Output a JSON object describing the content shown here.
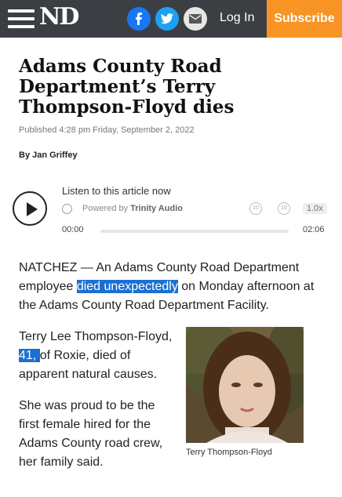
{
  "header": {
    "logo": "ND",
    "login_label": "Log In",
    "subscribe_label": "Subscribe"
  },
  "article": {
    "headline": "Adams County Road Department’s Terry Thompson-Floyd dies",
    "published": "Published 4:28 pm Friday, September 2, 2022",
    "byline": "By Jan Griffey",
    "p1_a": "NATCHEZ — An Adams County Road Department employee ",
    "p1_hl": "died unexpectedly",
    "p1_b": " on Monday afternoon at the Adams County Road Department Facility.",
    "p2_a": "Terry Lee Thompson-Floyd,",
    "p2_hl": " 41, ",
    "p2_b": "of Roxie, died of apparent natural causes.",
    "p3": "She was proud to be the first female hired for the Adams County road crew, her family said.",
    "photo_caption": "Terry Thompson-Floyd"
  },
  "audio": {
    "listen_label": "Listen to this article now",
    "powered_prefix": "Powered by",
    "powered_brand": "Trinity Audio",
    "rewind_label": "10",
    "forward_label": "10",
    "speed": "1.0x",
    "current_time": "00:00",
    "duration": "02:06",
    "progress": 0
  },
  "colors": {
    "topbar": "#3b3f44",
    "subscribe": "#f79423",
    "facebook": "#1877f2",
    "twitter": "#1da1f2",
    "highlight": "#1b6fd3"
  },
  "icons": [
    "menu-icon",
    "facebook-icon",
    "twitter-icon",
    "email-icon",
    "play-icon",
    "globe-icon",
    "rewind-10-icon",
    "forward-10-icon"
  ]
}
